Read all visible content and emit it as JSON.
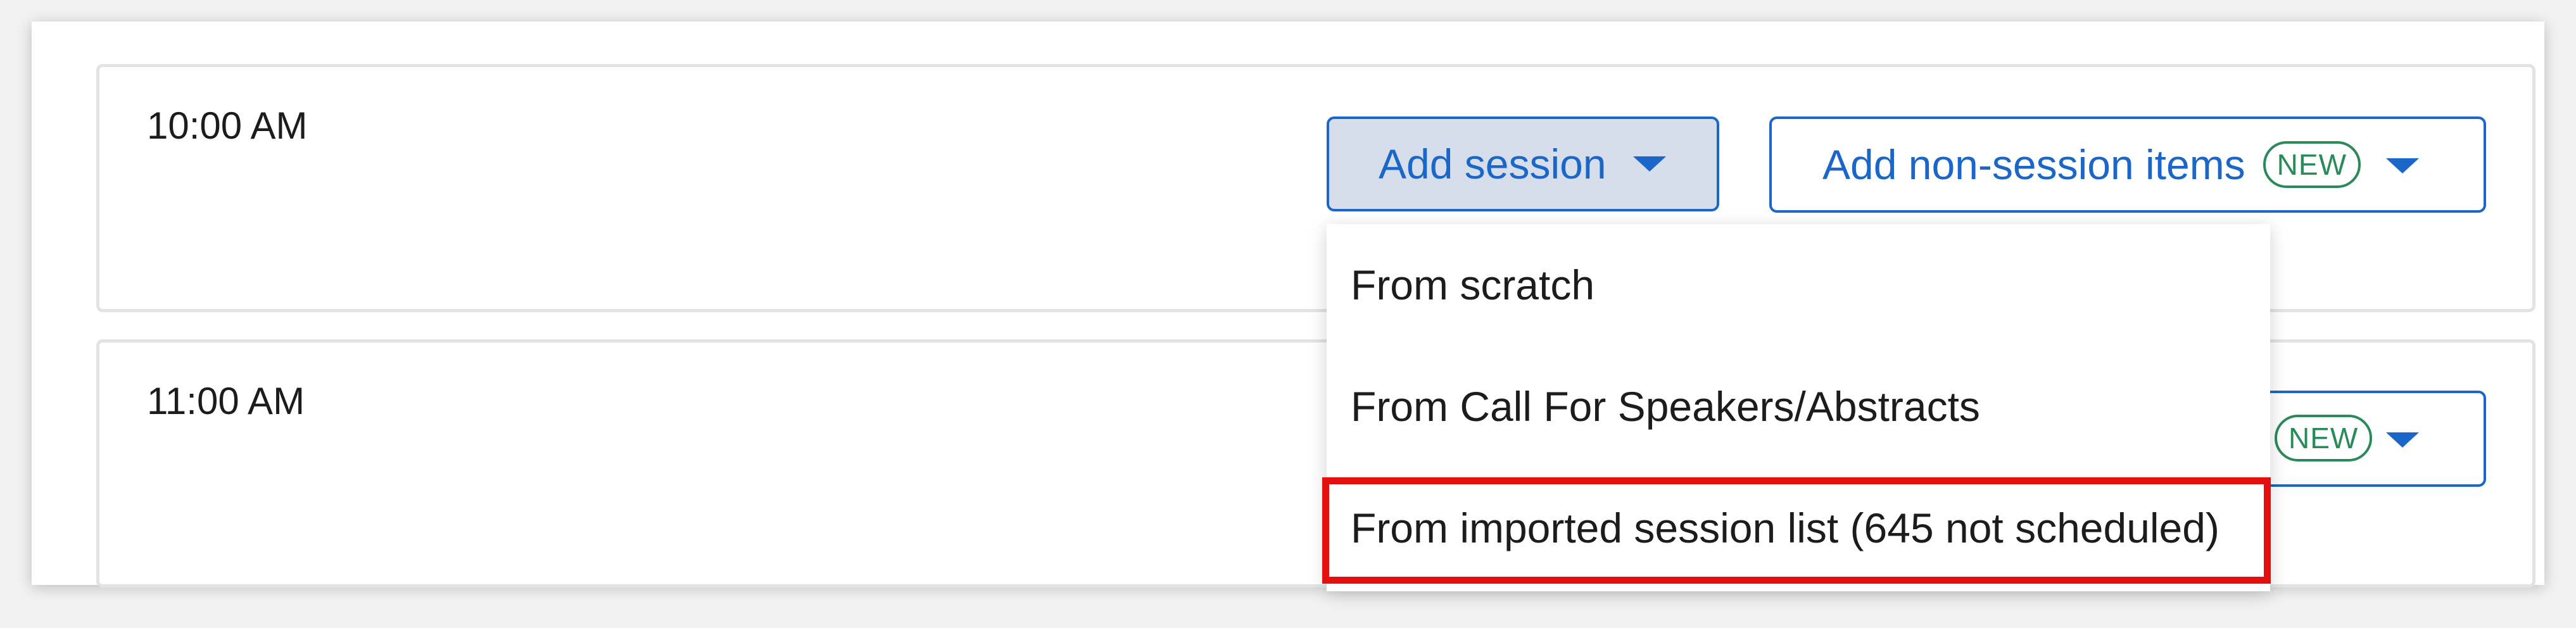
{
  "rows": [
    {
      "time": "10:00 AM"
    },
    {
      "time": "11:00 AM"
    }
  ],
  "add_session": {
    "label": "Add session"
  },
  "add_non_session": {
    "label": "Add non-session items",
    "badge": "NEW"
  },
  "dropdown": {
    "items": [
      {
        "label": "From scratch"
      },
      {
        "label": "From Call For Speakers/Abstracts"
      },
      {
        "label": "From imported session list (645 not scheduled)",
        "highlighted": true
      }
    ]
  },
  "colors": {
    "accent": "#1b66c9",
    "badge": "#2a8a5a",
    "highlight": "#e40f0f",
    "selected_button_bg": "#d5deea"
  },
  "icons": [
    "caret-down-icon"
  ]
}
